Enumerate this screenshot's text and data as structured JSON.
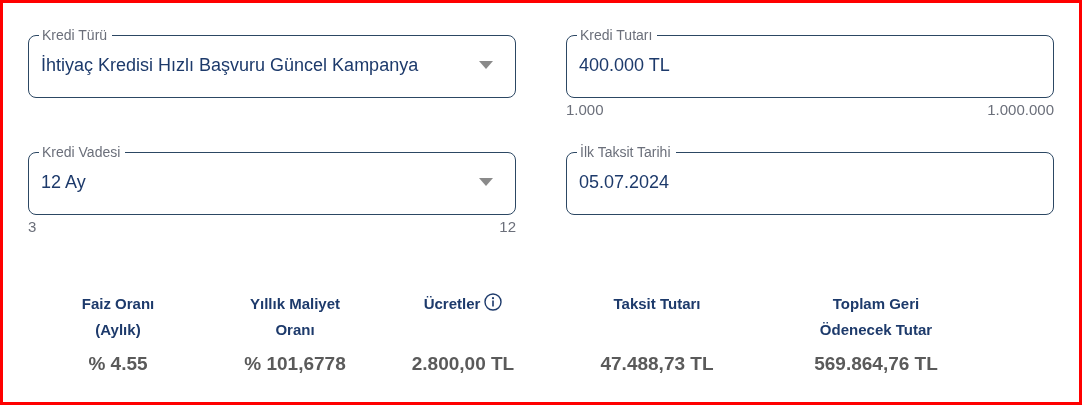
{
  "fields": [
    {
      "kind": "dropdown",
      "label": "Kredi Türü",
      "value": "İhtiyaç Kredisi Hızlı Başvuru Güncel Kampanya"
    },
    {
      "kind": "input",
      "label": "Kredi Tutarı",
      "value": "400.000 TL",
      "min": "1.000",
      "max": "1.000.000"
    },
    {
      "kind": "dropdown",
      "label": "Kredi Vadesi",
      "value": "12 Ay",
      "min": "3",
      "max": "12"
    },
    {
      "kind": "input",
      "label": "İlk Taksit Tarihi",
      "value": "05.07.2024"
    }
  ],
  "summary": [
    {
      "label": "Faiz Oranı\n(Aylık)",
      "value": "% 4.55",
      "info": false
    },
    {
      "label": "Yıllık Maliyet\nOranı",
      "value": "% 101,6778",
      "info": false
    },
    {
      "label": "Ücretler",
      "value": "2.800,00 TL",
      "info": true
    },
    {
      "label": "Taksit Tutarı",
      "value": "47.488,73 TL",
      "info": false
    },
    {
      "label": "Toplam Geri\nÖdenecek Tutar",
      "value": "569.864,76 TL",
      "info": false
    }
  ]
}
